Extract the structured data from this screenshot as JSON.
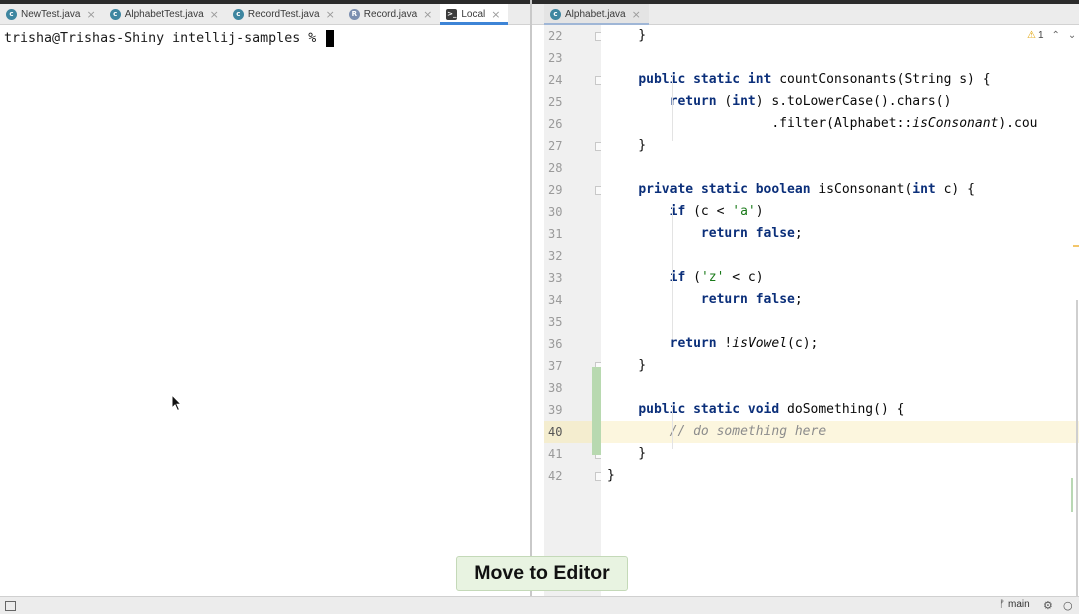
{
  "left_tabs": [
    {
      "label": "NewTest.java",
      "icon": "java-class-icon",
      "state": "normal"
    },
    {
      "label": "AlphabetTest.java",
      "icon": "java-class-icon",
      "state": "normal"
    },
    {
      "label": "RecordTest.java",
      "icon": "java-class-icon",
      "state": "normal"
    },
    {
      "label": "Record.java",
      "icon": "java-record-icon",
      "state": "normal"
    },
    {
      "label": "Local",
      "icon": "terminal-icon",
      "state": "active"
    }
  ],
  "right_tabs": [
    {
      "label": "Alphabet.java",
      "icon": "java-class-icon",
      "state": "selected"
    }
  ],
  "terminal": {
    "prompt": "trisha@Trishas-Shiny intellij-samples % "
  },
  "editor": {
    "inspection_count": "1",
    "current_line": 40,
    "lines": [
      {
        "n": "22",
        "text": "    }"
      },
      {
        "n": "23",
        "text": ""
      },
      {
        "n": "24",
        "text": "    public static int countConsonants(String s) {"
      },
      {
        "n": "25",
        "text": "        return (int) s.toLowerCase().chars()"
      },
      {
        "n": "26",
        "text": "                     .filter(Alphabet::isConsonant).cou"
      },
      {
        "n": "27",
        "text": "    }"
      },
      {
        "n": "28",
        "text": ""
      },
      {
        "n": "29",
        "text": "    private static boolean isConsonant(int c) {"
      },
      {
        "n": "30",
        "text": "        if (c < 'a')"
      },
      {
        "n": "31",
        "text": "            return false;"
      },
      {
        "n": "32",
        "text": ""
      },
      {
        "n": "33",
        "text": "        if ('z' < c)"
      },
      {
        "n": "34",
        "text": "            return false;"
      },
      {
        "n": "35",
        "text": ""
      },
      {
        "n": "36",
        "text": "        return !isVowel(c);"
      },
      {
        "n": "37",
        "text": "    }"
      },
      {
        "n": "38",
        "text": ""
      },
      {
        "n": "39",
        "text": "    public static void doSomething() {"
      },
      {
        "n": "40",
        "text": "        // do something here"
      },
      {
        "n": "41",
        "text": "    }"
      },
      {
        "n": "42",
        "text": "}"
      }
    ]
  },
  "overlay": {
    "action_hint": "Move to Editor"
  },
  "status_bar": {
    "branch": "main"
  },
  "colors": {
    "keyword": "#0b2f7a",
    "string": "#1a7a1a",
    "comment": "#8c8c8c",
    "accent": "#3d84d6",
    "highlight_line": "#fcf6de",
    "hint_bg": "#e8f3e1"
  }
}
